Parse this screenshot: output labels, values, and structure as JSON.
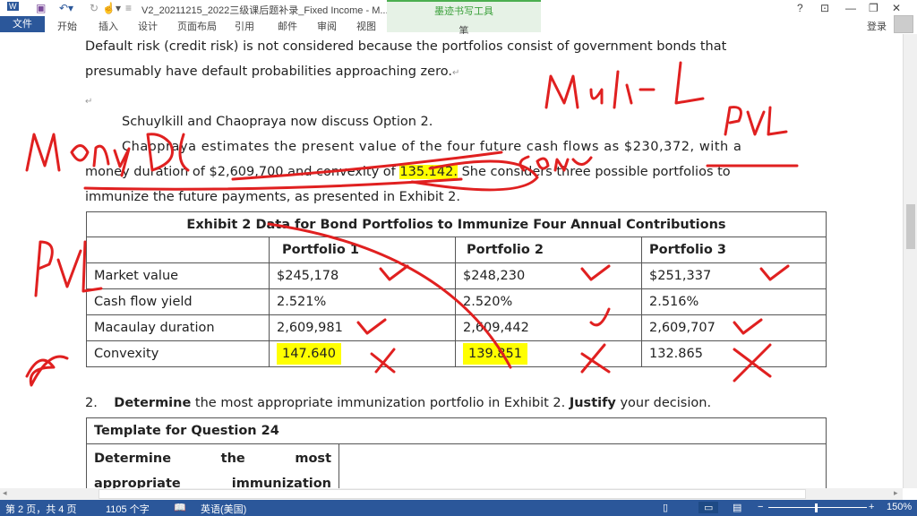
{
  "titlebar": {
    "title": "V2_20211215_2022三级课后题补录_Fixed Income - M...",
    "ink_tools": "墨迹书写工具",
    "ink_pen": "笔",
    "help": "?",
    "login": "登录"
  },
  "ribbon": {
    "tabs": [
      "文件",
      "开始",
      "插入",
      "设计",
      "页面布局",
      "引用",
      "邮件",
      "审阅",
      "视图"
    ]
  },
  "doc": {
    "para1_l1": "Default risk (credit risk) is not considered because the portfolios consist of government bonds that",
    "para1_l2": "presumably have default probabilities approaching zero.",
    "para2": "Schuylkill and Chaopraya now discuss Option 2.",
    "para3_l1": "Chaopraya estimates the present value of the four future cash flows as $230,372, with a",
    "para3_l2a": "money duration of $2,609,700 and convexity of ",
    "para3_l2b": "135.142.",
    "para3_l2c": " She considers three possible portfolios to",
    "para3_l3": "immunize the future payments, as presented in Exhibit 2.",
    "exhibit_title": "Exhibit 2 Data for Bond Portfolios to Immunize Four Annual Contributions",
    "headers": [
      "",
      "Portfolio 1",
      "Portfolio 2",
      "Portfolio 3"
    ],
    "rows": [
      [
        "Market value",
        "$245,178",
        "$248,230",
        "$251,337"
      ],
      [
        "Cash flow yield",
        "2.521%",
        "2.520%",
        "2.516%"
      ],
      [
        "Macaulay duration",
        "2,609,981",
        "2,609,442",
        "2,609,707"
      ],
      [
        "Convexity",
        "147.640",
        "139.851",
        "132.865"
      ]
    ],
    "q_num": "2.",
    "q_bold1": "Determine",
    "q_text1": " the most appropriate immunization portfolio in Exhibit 2. ",
    "q_bold2": "Justify",
    "q_text2": " your decision.",
    "template_title": "Template for Question 24",
    "template_cell_l1": "Determine the most",
    "template_cell_l2": "appropriate immunization"
  },
  "status": {
    "page": "第 2 页，共 4 页",
    "words": "1105 个字",
    "lang": "英语(美国)",
    "zoom": "150%",
    "zoom_level": 150
  },
  "colors": {
    "accent": "#2b579a",
    "ink": "#e02020",
    "highlight": "#ffff00"
  }
}
